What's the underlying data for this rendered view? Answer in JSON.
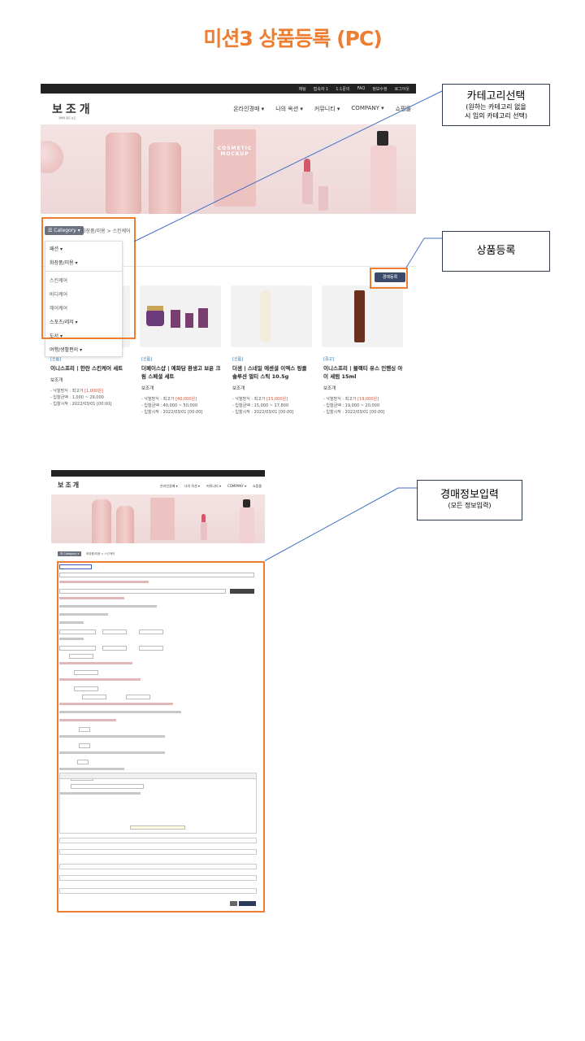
{
  "page_title": "미션3 상품등록 (PC)",
  "shot1": {
    "topbar": [
      "채팅",
      "접속자 1",
      "1:1문의",
      "FAQ",
      "정보수정",
      "로그아웃"
    ],
    "logo": "보조개",
    "logo_sub": "경매의 원조 보조",
    "nav": [
      "온라인경매 ▾",
      "나의 옥션 ▾",
      "커뮤니티 ▾",
      "COMPANY ▾",
      "쇼핑몰"
    ],
    "hero": {
      "pouch_text": "COSMETIC MOCKUP",
      "tube_text": "COSMETIC MOCKUP"
    },
    "category_button": "☰ Category ▾",
    "breadcrumb": "화장품/미용 > 스킨케어",
    "dropdown": [
      {
        "label": "패션 ▾",
        "sub": false
      },
      {
        "label": "화장품/미용 ▾",
        "sub": false
      },
      {
        "label": "스킨케어",
        "sub": true
      },
      {
        "label": "바디케어",
        "sub": true
      },
      {
        "label": "헤어케어",
        "sub": true
      },
      {
        "label": "스포츠/레저 ▾",
        "sub": false
      },
      {
        "label": "도서 ▾",
        "sub": false
      },
      {
        "label": "여행/생활편의 ▾",
        "sub": false
      }
    ],
    "register_button": "경매등록",
    "cards": [
      {
        "tag": "[신품]",
        "name": "이니스프리 | 한란 스킨케어 세트",
        "seller": "보조개",
        "method": "- 낙찰방식 : 최고가",
        "start_price": "[1,000원]",
        "bid_range": "- 입찰금액 : 1,000 ~ 29,000",
        "start": "- 입찰시작 : 2022/03/01 [00:00]"
      },
      {
        "tag": "[신품]",
        "name": "더페이스샵 | 예화담 환생고 보윤 크림 스페셜 세트",
        "seller": "보조개",
        "method": "- 낙찰방식 : 최고가",
        "start_price": "[40,000원]",
        "bid_range": "- 입찰금액 : 40,000 ~ 50,000",
        "start": "- 입찰시작 : 2022/03/01 [00:00]"
      },
      {
        "tag": "[신품]",
        "name": "더샘 | 스네일 에센셜 이엑스 링클 솔루션 멀티 스틱 10.5g",
        "seller": "보조개",
        "method": "- 낙찰방식 : 최고가",
        "start_price": "[15,000원]",
        "bid_range": "- 입찰금액 : 15,000 ~ 17,800",
        "start": "- 입찰시작 : 2022/03/01 [00:00]"
      },
      {
        "tag": "[중고]",
        "name": "이니스프리 | 블랙티 유스 인핸싱 아이 세럼 15ml",
        "seller": "보조개",
        "method": "- 낙찰방식 : 최고가",
        "start_price": "[19,000원]",
        "bid_range": "- 입찰금액 : 19,000 ~ 20,000",
        "start": "- 입찰시작 : 2022/03/01 [00:00]"
      }
    ]
  },
  "notes": {
    "category": {
      "big": "카테고리선택",
      "small1": "(원하는 카테고리 없을",
      "small2": "시 임의 카테고리 선택)"
    },
    "register": {
      "big": "상품등록"
    },
    "auction_info": {
      "big": "경매정보입력",
      "small": "(모든 정보입력)"
    }
  },
  "shot2": {
    "logo": "보조개",
    "nav": [
      "온라인경매 ▾",
      "나의 옥션 ▾",
      "커뮤니티 ▾",
      "COMPANY ▾",
      "쇼핑몰"
    ],
    "category_button": "☰ Category ▾",
    "breadcrumb": "화장품/미용 > 스킨케어"
  },
  "colors": {
    "accent": "#ed7d31",
    "dark_button": "#3b4a6b",
    "price_red": "#e24a2e",
    "tag_blue": "#2e75b6"
  }
}
